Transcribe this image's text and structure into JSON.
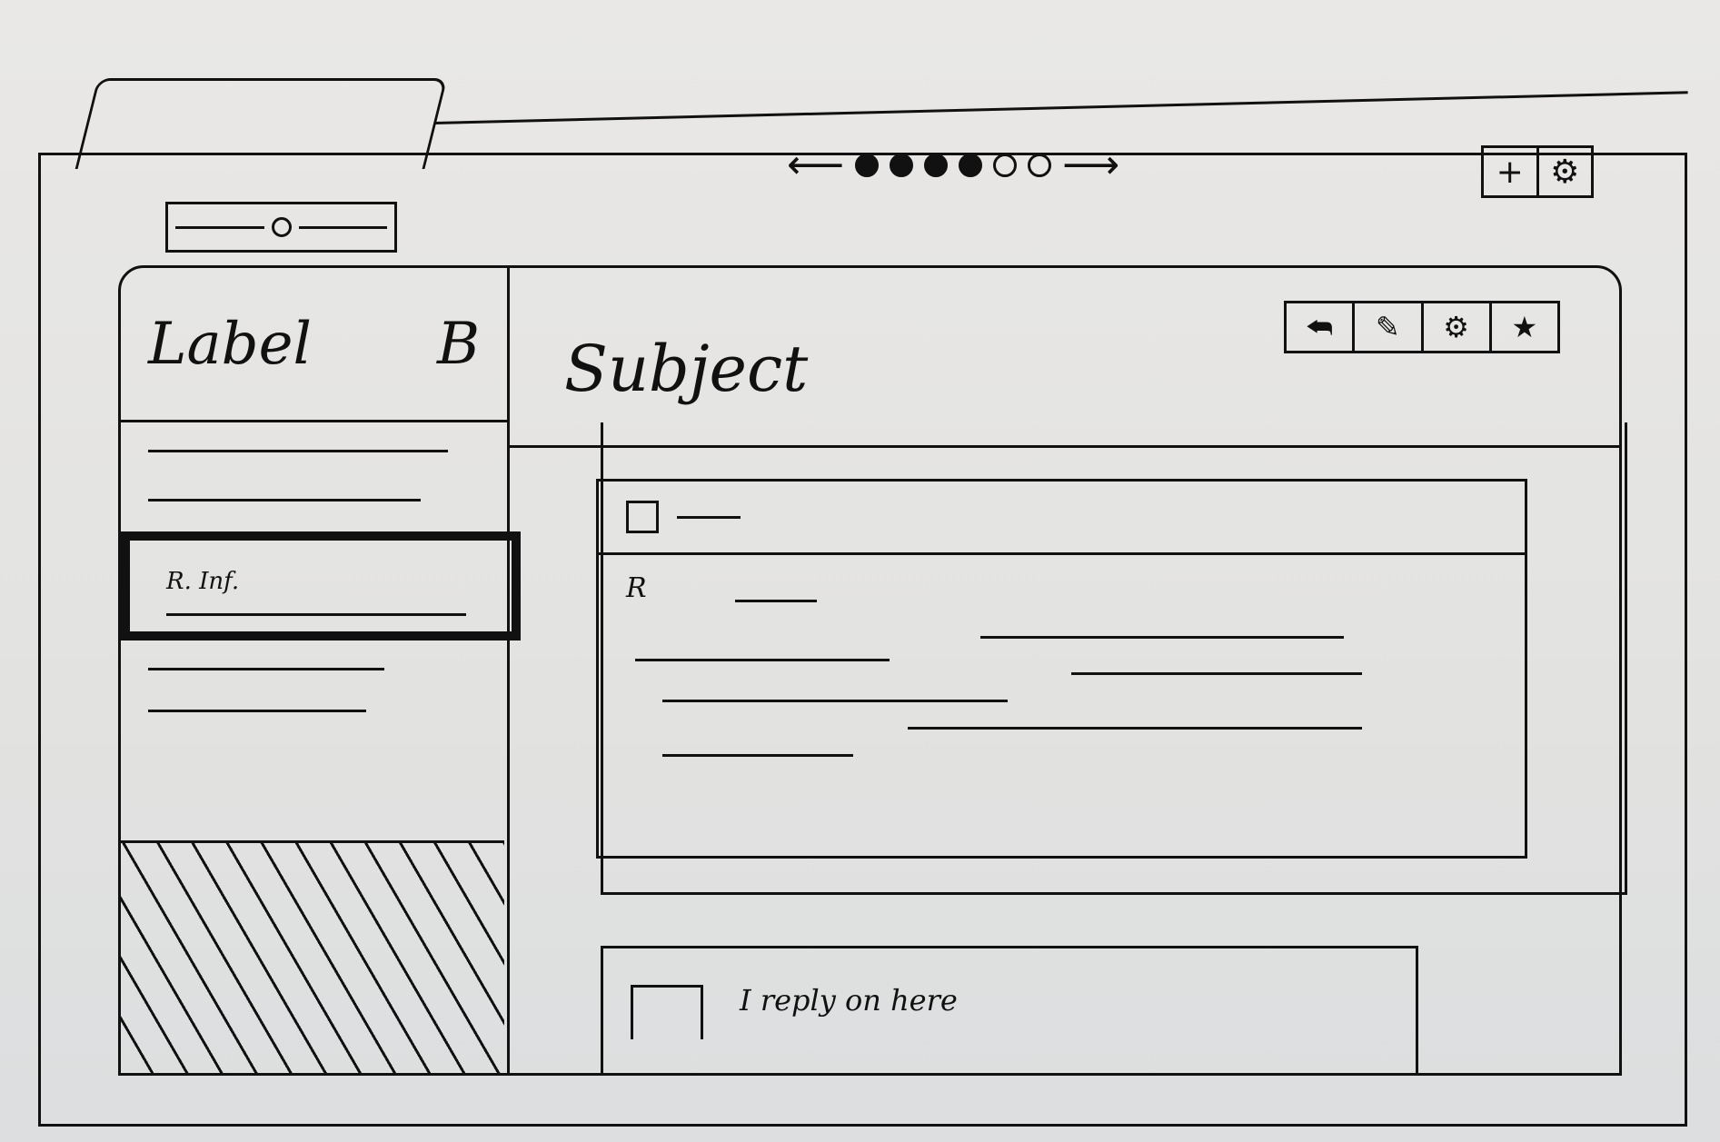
{
  "carousel": {
    "prev_arrow": "⟵",
    "next_arrow": "⟶",
    "dots": [
      true,
      true,
      true,
      true,
      false,
      false
    ]
  },
  "window_controls": {
    "add_label": "+",
    "settings_label": "⚙"
  },
  "sidebar": {
    "title": "Label",
    "title_right": "B",
    "selected_item_label": "R. Inf."
  },
  "main": {
    "subject": "Subject",
    "toolbar": [
      "⮪",
      "✎",
      "⚙",
      "★"
    ],
    "sender": "R"
  },
  "reply": {
    "placeholder": "I reply on here"
  }
}
